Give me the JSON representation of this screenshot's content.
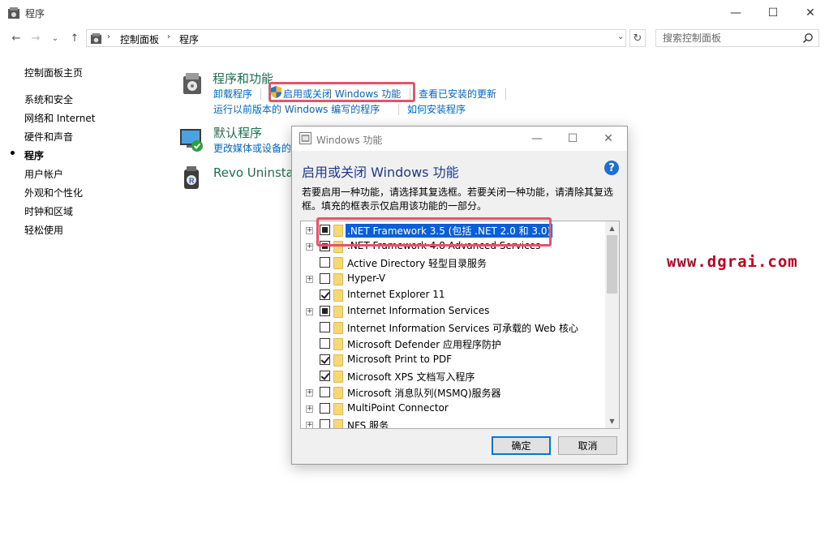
{
  "window": {
    "title": "程序",
    "minimize_glyph": "—",
    "maximize_glyph": "☐",
    "close_glyph": "✕"
  },
  "nav": {
    "back_glyph": "←",
    "forward_glyph": "→",
    "recent_glyph": "⌄",
    "up_glyph": "↑"
  },
  "address": {
    "crumbs": [
      "控制面板",
      "程序"
    ],
    "separator": "›",
    "dropdown_glyph": "⌄",
    "refresh_glyph": "↻"
  },
  "search": {
    "placeholder": "搜索控制面板"
  },
  "sidebar": {
    "home": "控制面板主页",
    "items": [
      {
        "label": "系统和安全"
      },
      {
        "label": "网络和 Internet"
      },
      {
        "label": "硬件和声音"
      },
      {
        "label": "程序",
        "active": true
      },
      {
        "label": "用户帐户"
      },
      {
        "label": "外观和个性化"
      },
      {
        "label": "时钟和区域"
      },
      {
        "label": "轻松使用"
      }
    ]
  },
  "sections": {
    "programs": {
      "title": "程序和功能",
      "links": [
        "卸载程序",
        "启用或关闭 Windows 功能",
        "查看已安装的更新",
        "运行以前版本的 Windows 编写的程序",
        "如何安装程序"
      ]
    },
    "defaults": {
      "title": "默认程序",
      "links": [
        "更改媒体或设备的"
      ]
    },
    "revo": {
      "title": "Revo Uninsta"
    }
  },
  "watermark": "www.dgrai.com",
  "dialog": {
    "title": "Windows 功能",
    "heading": "启用或关闭 Windows 功能",
    "help_glyph": "?",
    "description": "若要启用一种功能，请选择其复选框。若要关闭一种功能，请清除其复选框。填充的框表示仅启用该功能的一部分。",
    "features": [
      {
        "label": ".NET Framework 3.5 (包括 .NET 2.0 和 3.0)",
        "state": "partial",
        "expandable": true,
        "selected": true
      },
      {
        "label": ".NET Framework 4.8 Advanced Services",
        "state": "partial",
        "expandable": true
      },
      {
        "label": "Active Directory 轻型目录服务",
        "state": "unchecked",
        "expandable": false
      },
      {
        "label": "Hyper-V",
        "state": "unchecked",
        "expandable": true
      },
      {
        "label": "Internet Explorer 11",
        "state": "checked",
        "expandable": false
      },
      {
        "label": "Internet Information Services",
        "state": "partial",
        "expandable": true
      },
      {
        "label": "Internet Information Services 可承载的 Web 核心",
        "state": "unchecked",
        "expandable": false
      },
      {
        "label": "Microsoft Defender 应用程序防护",
        "state": "unchecked",
        "expandable": false
      },
      {
        "label": "Microsoft Print to PDF",
        "state": "checked",
        "expandable": false
      },
      {
        "label": "Microsoft XPS 文档写入程序",
        "state": "checked",
        "expandable": true
      },
      {
        "label": "Microsoft 消息队列(MSMQ)服务器",
        "state": "unchecked",
        "expandable": true
      },
      {
        "label": "MultiPoint Connector",
        "state": "unchecked",
        "expandable": true
      },
      {
        "label": "NFS 服务",
        "state": "unchecked",
        "expandable": true
      }
    ],
    "scroll_up_glyph": "▲",
    "scroll_down_glyph": "▼",
    "ok_label": "确定",
    "cancel_label": "取消"
  }
}
